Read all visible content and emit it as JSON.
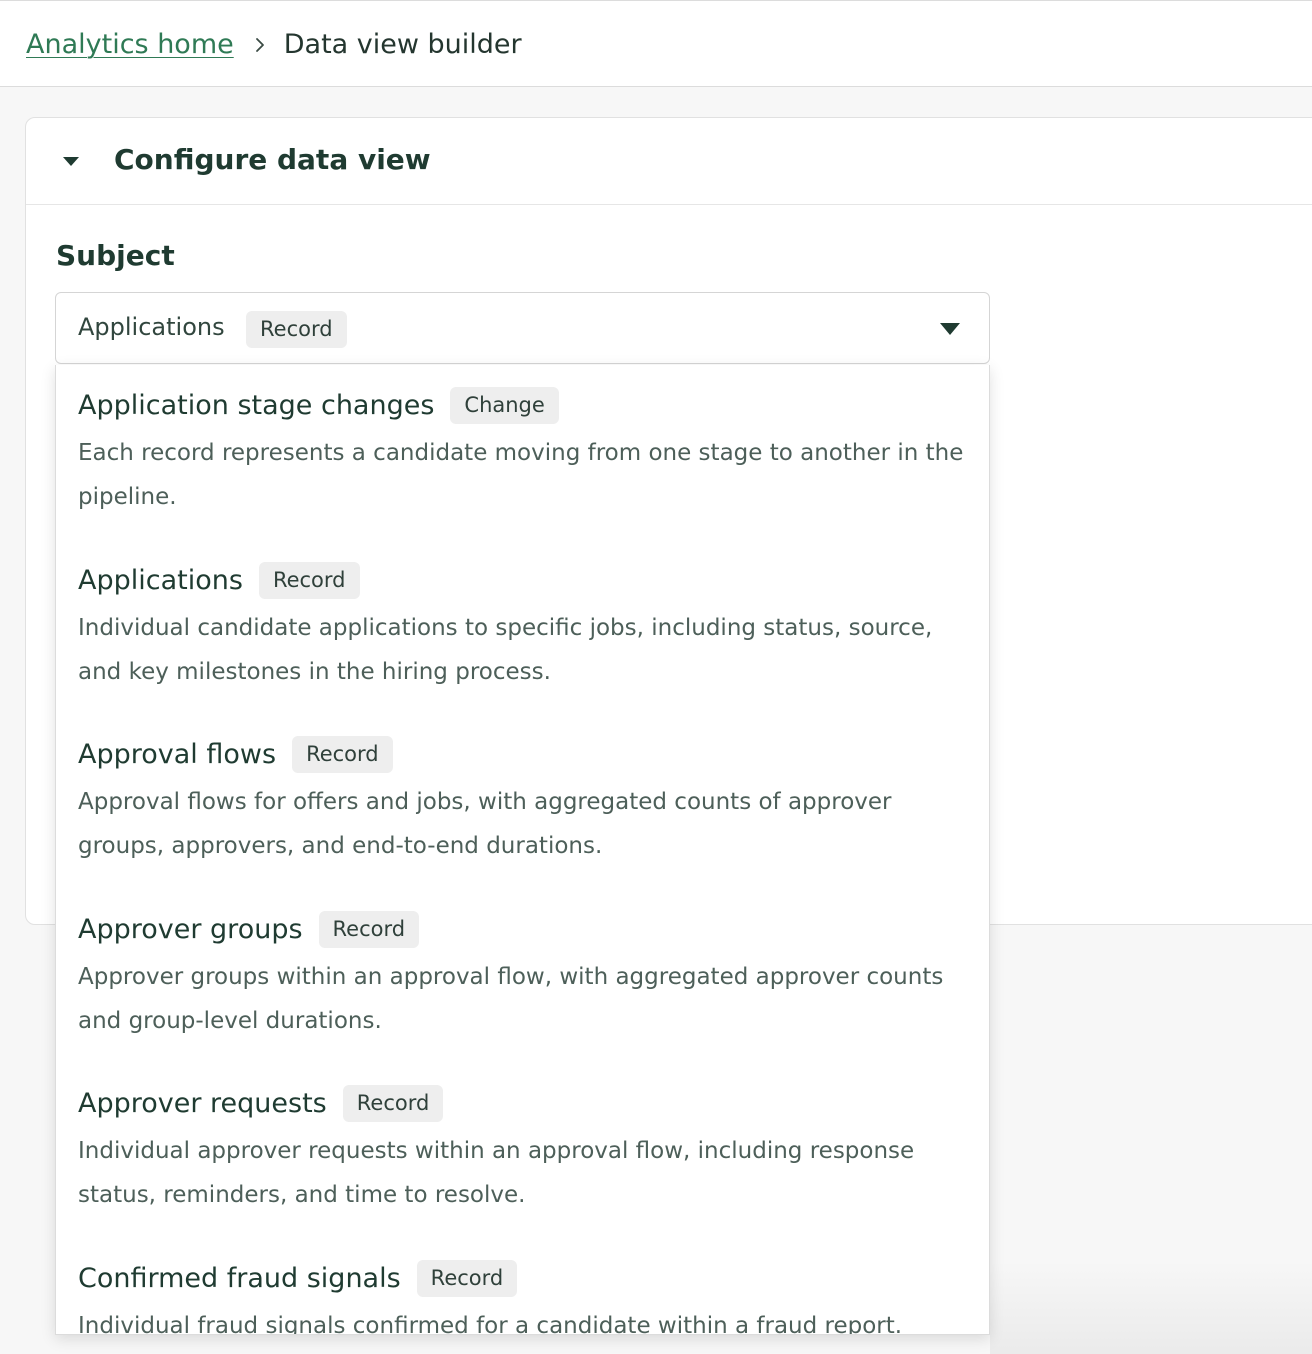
{
  "breadcrumb": {
    "home_label": "Analytics home",
    "current_label": "Data view builder"
  },
  "panel": {
    "title": "Configure data view"
  },
  "subject": {
    "label": "Subject",
    "selected_value": "Applications",
    "selected_badge": "Record"
  },
  "options": [
    {
      "title": "Application stage changes",
      "badge": "Change",
      "description": "Each record represents a candidate moving from one stage to another in the pipeline."
    },
    {
      "title": "Applications",
      "badge": "Record",
      "description": "Individual candidate applications to specific jobs, including status, source, and key milestones in the hiring process."
    },
    {
      "title": "Approval flows",
      "badge": "Record",
      "description": "Approval flows for offers and jobs, with aggregated counts of approver groups, approvers, and end-to-end durations."
    },
    {
      "title": "Approver groups",
      "badge": "Record",
      "description": "Approver groups within an approval flow, with aggregated approver counts and group-level durations."
    },
    {
      "title": "Approver requests",
      "badge": "Record",
      "description": "Individual approver requests within an approval flow, including response status, reminders, and time to resolve."
    },
    {
      "title": "Confirmed fraud signals",
      "badge": "Record",
      "description": "Individual fraud signals confirmed for a candidate within a fraud report."
    }
  ],
  "colors": {
    "link": "#2f7a55",
    "heading": "#1f3b31",
    "muted_text": "#4d5f59",
    "badge_bg": "#eeeeee",
    "page_bg": "#f7f7f7"
  },
  "icons": {
    "breadcrumb_separator": "chevron-right-icon",
    "panel_toggle": "caret-down-icon",
    "select_toggle": "caret-down-icon"
  }
}
